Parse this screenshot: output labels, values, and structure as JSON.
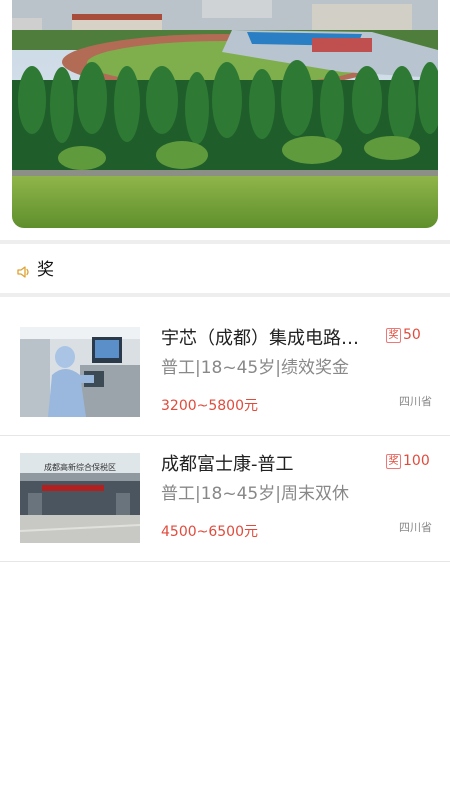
{
  "notice": {
    "text": "奖"
  },
  "jobs": [
    {
      "title": "宇芯（成都）集成电路封装测试有限公司",
      "tags": "普工|18~45岁|绩效奖金",
      "salary": "3200~5800元",
      "location": "四川省",
      "award_icon": "奖",
      "award_amount": "50"
    },
    {
      "title": "成都富士康-普工",
      "tags": "普工|18~45岁|周末双休",
      "salary": "4500~6500元",
      "location": "四川省",
      "award_icon": "奖",
      "award_amount": "100"
    }
  ],
  "thumb2": {
    "sign_text": "成都高新综合保税区"
  },
  "icons": {
    "notice": "speaker-icon"
  },
  "colors": {
    "accent": "#e04b3c",
    "separator": "#eeeeee",
    "speaker": "#e0a030"
  }
}
